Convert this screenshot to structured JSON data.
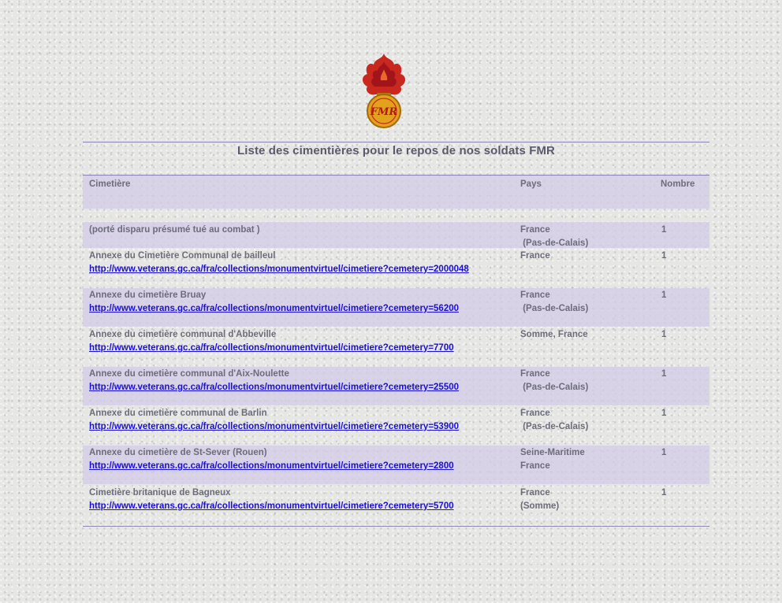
{
  "emblem": {
    "monogram": "FMR",
    "icon": "flaming-grenade-emblem"
  },
  "colors": {
    "rule": "#8c84b0",
    "band": "#d4cce8",
    "text": "#6c6c7a",
    "title": "#5a5a6e",
    "link": "#1a0fd6",
    "flame_red": "#c8281e",
    "grenade_gold": "#e2a21c"
  },
  "page_title": "Liste des cimentières pour le repos de nos soldats FMR",
  "table": {
    "headers": {
      "cemetery": "Cimetière",
      "country": "Pays",
      "count": "Nombre"
    },
    "rows": [
      {
        "name": "(porté disparu présumé tué au  combat )",
        "url": "",
        "country": [
          "France",
          " (Pas-de-Calais)"
        ],
        "count": "1"
      },
      {
        "name": "Annexe du Cimetière  Communal de bailleul",
        "url": "http://www.veterans.gc.ca/fra/collections/monumentvirtuel/cimetiere?cemetery=2000048",
        "country": [
          "France",
          ""
        ],
        "count": "1"
      },
      {
        "name": "Annexe du cimetière Bruay",
        "url": "http://www.veterans.gc.ca/fra/collections/monumentvirtuel/cimetiere?cemetery=56200",
        "country": [
          "France",
          " (Pas-de-Calais)"
        ],
        "count": "1"
      },
      {
        "name": "Annexe du cimetière communal d'Abbeville",
        "url": "http://www.veterans.gc.ca/fra/collections/monumentvirtuel/cimetiere?cemetery=7700",
        "country": [
          "Somme, France",
          ""
        ],
        "count": "1"
      },
      {
        "name": "Annexe du cimetière communal d'Aix-Noulette",
        "url": "http://www.veterans.gc.ca/fra/collections/monumentvirtuel/cimetiere?cemetery=25500",
        "country": [
          "France",
          " (Pas-de-Calais)"
        ],
        "count": "1"
      },
      {
        "name": "Annexe du cimetière communal de Barlin",
        "url": "http://www.veterans.gc.ca/fra/collections/monumentvirtuel/cimetiere?cemetery=53900",
        "country": [
          "France",
          " (Pas-de-Calais)"
        ],
        "count": "1"
      },
      {
        "name": "Annexe du cimetière de St-Sever (Rouen)",
        "url": "http://www.veterans.gc.ca/fra/collections/monumentvirtuel/cimetiere?cemetery=2800",
        "country": [
          "Seine-Maritime",
          "France"
        ],
        "count": "1"
      },
      {
        "name": "Cimetière britanique de Bagneux",
        "url": "http://www.veterans.gc.ca/fra/collections/monumentvirtuel/cimetiere?cemetery=5700",
        "country": [
          "France",
          "(Somme)"
        ],
        "count": "1"
      }
    ]
  }
}
